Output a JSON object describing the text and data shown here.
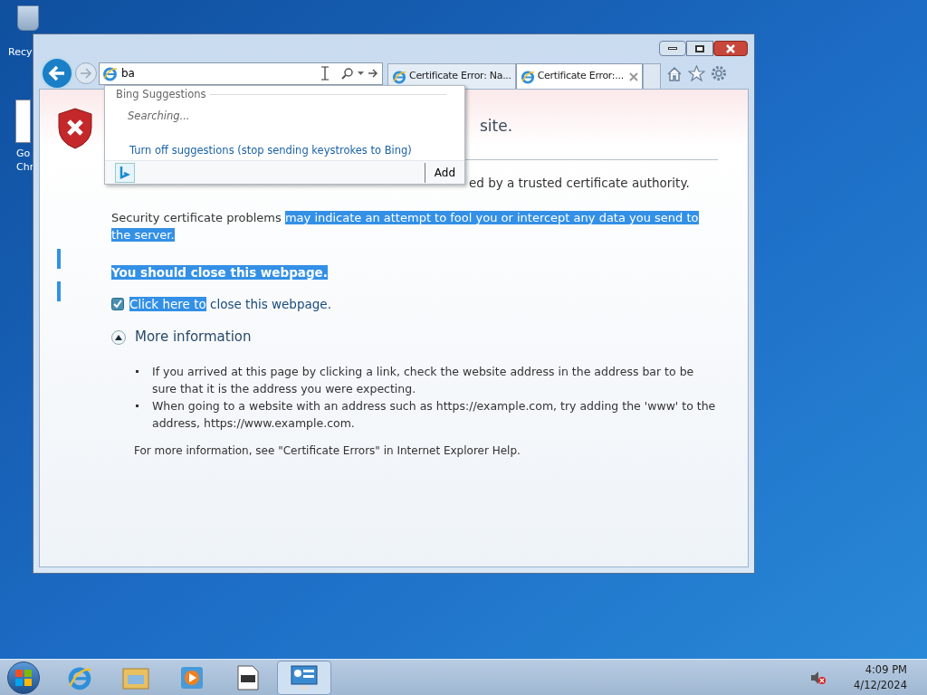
{
  "desktop_icons": [
    {
      "lines": [
        "Recy"
      ]
    },
    {
      "lines": [
        "Go",
        "Chr"
      ]
    }
  ],
  "browser": {
    "address": {
      "value": "ba"
    },
    "tabs": [
      {
        "label": "Certificate Error: Na...",
        "selected": false
      },
      {
        "label": "Certificate Error:...",
        "selected": true
      }
    ],
    "suggestions": {
      "header": "Bing Suggestions",
      "status": "Searching...",
      "link": "Turn off suggestions (stop sending keystrokes to Bing)",
      "add": "Add"
    },
    "page": {
      "heading_tail": "site.",
      "line_tail": "ed by a trusted certificate authority.",
      "paragraph": [
        {
          "text": "Security certificate problems ",
          "selected": false
        },
        {
          "text": "may indicate an attempt to fool you or intercept any data you send to the server.",
          "selected": true
        }
      ],
      "warning": {
        "text": "You should close this webpage.",
        "selected": true
      },
      "close_link": [
        {
          "text": "Click here to",
          "selected": true
        },
        {
          "text": " close this webpage.",
          "selected": false
        }
      ],
      "more": {
        "label": "More information",
        "expanded": true
      },
      "bullets": [
        "If you arrived at this page by clicking a link, check the website address in the address bar to be sure that it is the address you were expecting.",
        "When going to a website with an address such as https://example.com, try adding the 'www' to the address, https://www.example.com."
      ],
      "footer": "For more information, see \"Certificate Errors\" in Internet Explorer Help."
    }
  },
  "taskbar": {
    "apps": [
      {
        "kind": "ie",
        "active": false
      },
      {
        "kind": "folder",
        "active": false
      },
      {
        "kind": "media",
        "active": false
      },
      {
        "kind": "notepad",
        "active": false
      },
      {
        "kind": "control",
        "active": true
      }
    ],
    "time": "4:09 PM",
    "date": "4/12/2024"
  }
}
